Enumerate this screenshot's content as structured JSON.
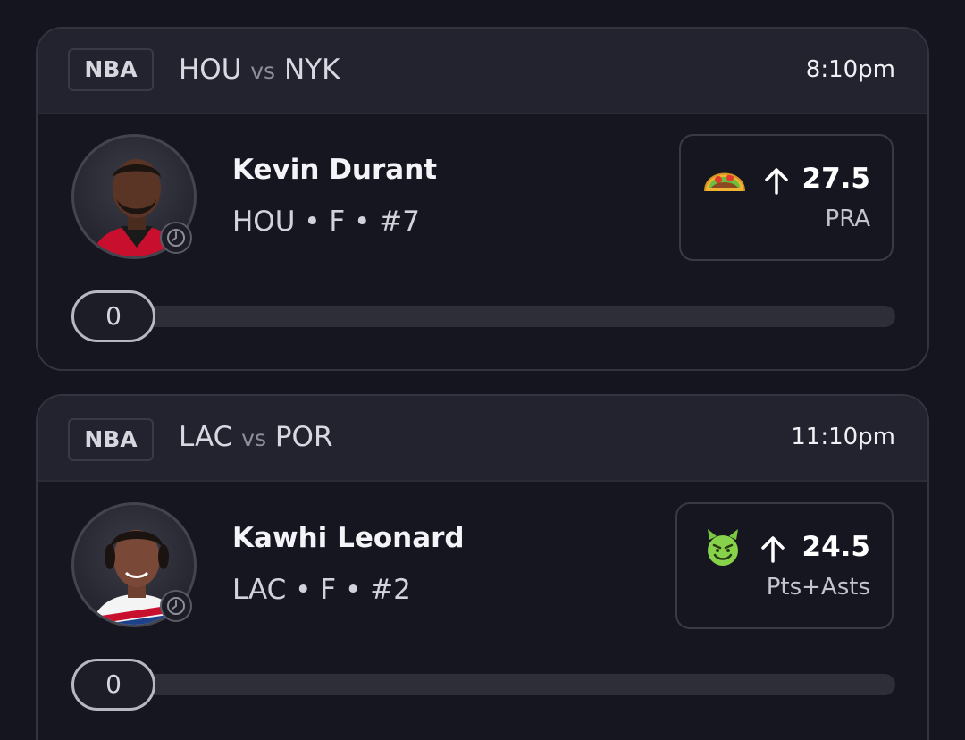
{
  "picks": [
    {
      "league": "NBA",
      "away_team": "HOU",
      "vs_label": "vs",
      "home_team": "NYK",
      "game_time": "8:10pm",
      "player_name": "Kevin Durant",
      "player_meta": "HOU • F • #7",
      "pick_icon": "taco-icon",
      "direction_icon": "arrow-up-icon",
      "line": "27.5",
      "stat_type": "PRA",
      "progress_value": "0",
      "progress_fraction": 0,
      "jersey_color": "#c8102e"
    },
    {
      "league": "NBA",
      "away_team": "LAC",
      "vs_label": "vs",
      "home_team": "POR",
      "game_time": "11:10pm",
      "player_name": "Kawhi Leonard",
      "player_meta": "LAC • F • #2",
      "pick_icon": "smiling-devil-icon",
      "direction_icon": "arrow-up-icon",
      "line": "24.5",
      "stat_type": "Pts+Asts",
      "progress_value": "0",
      "progress_fraction": 0,
      "jersey_color": "#1d428a"
    }
  ],
  "theme": {
    "background": "#15151f",
    "card_header": "#232330",
    "border": "#34343e",
    "track": "#2e2e38"
  }
}
